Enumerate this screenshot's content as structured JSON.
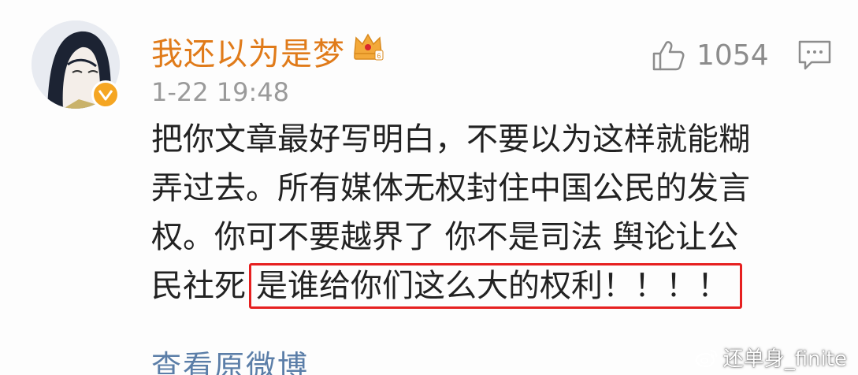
{
  "comment": {
    "username": "我还以为是梦",
    "timestamp": "1-22 19:48",
    "like_count": "1054",
    "content_lines": [
      "把你文章最好写明白，不要以为这样就能糊",
      "弄过去。所有媒体无权封住中国公民的发言",
      "权。你可不要越界了 你不是司法 舆论让公"
    ],
    "last_line_prefix": "民社死",
    "highlighted_text": "是谁给你们这么大的权利！！！！",
    "view_original_label": "查看原微博"
  },
  "watermark": {
    "text": "还单身_finite",
    "icon": "weibo-icon"
  },
  "icons": {
    "avatar": "avatar",
    "verified": "verified-badge-icon",
    "crown": "crown-icon",
    "like": "thumbs-up-icon",
    "comment": "comment-icon"
  },
  "colors": {
    "username": "#e07b1a",
    "highlight_border": "#e62020",
    "link": "#5b7ea8",
    "meta": "#9a9a9a",
    "verified": "#f5a623"
  }
}
